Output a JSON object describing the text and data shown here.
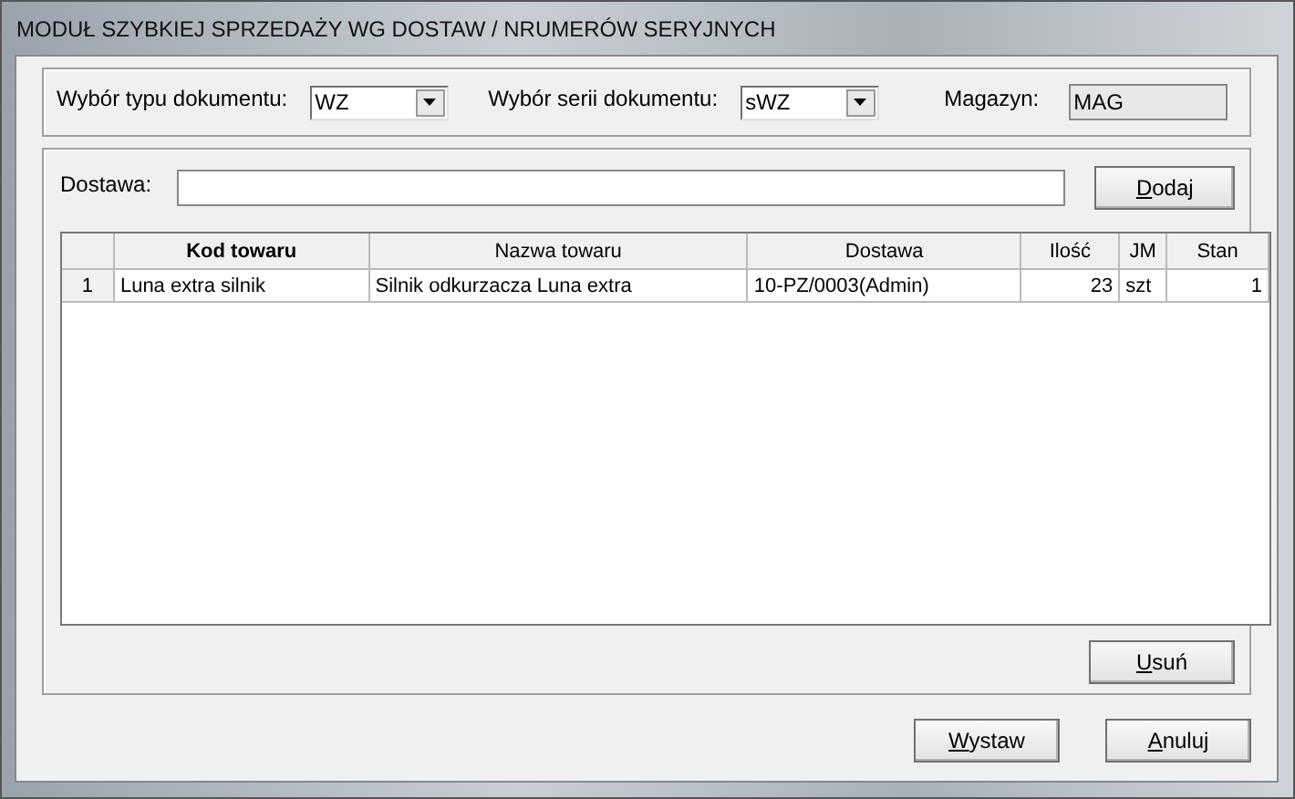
{
  "window": {
    "title": "MODUŁ SZYBKIEJ SPRZEDAŻY WG DOSTAW / NRUMERÓW SERYJNYCH"
  },
  "header": {
    "doc_type": {
      "label": "Wybór typu dokumentu:",
      "value": "WZ"
    },
    "doc_series": {
      "label": "Wybór serii dokumentu:",
      "value": "sWZ"
    },
    "warehouse": {
      "label": "Magazyn:",
      "value": "MAG"
    }
  },
  "delivery": {
    "label": "Dostawa:",
    "add_button": {
      "key": "D",
      "rest": "odaj"
    }
  },
  "table": {
    "columns": [
      {
        "label": "Kod towaru",
        "bold": true
      },
      {
        "label": "Nazwa towaru",
        "bold": false
      },
      {
        "label": "Dostawa",
        "bold": false
      },
      {
        "label": "Ilość",
        "bold": false
      },
      {
        "label": "JM",
        "bold": false
      },
      {
        "label": "Stan",
        "bold": false
      }
    ],
    "rows": [
      {
        "number": "1",
        "cells": [
          "Luna extra silnik",
          "Silnik odkurzacza Luna extra",
          "10-PZ/0003(Admin)",
          "23",
          "szt",
          "1"
        ]
      }
    ]
  },
  "remove_button": {
    "key": "U",
    "rest": "suń"
  },
  "buttons": [
    {
      "key": "W",
      "rest": "ystaw"
    },
    {
      "key": "A",
      "rest": "nuluj"
    }
  ]
}
